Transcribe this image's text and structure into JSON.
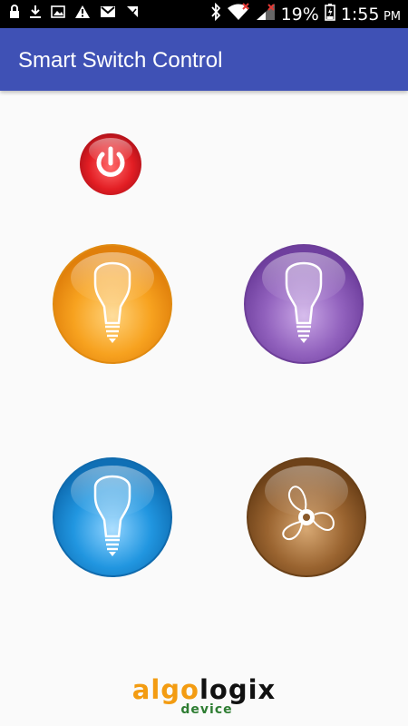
{
  "status_bar": {
    "battery_percent": "19%",
    "time": "1:55",
    "ampm": "PM",
    "icons": [
      "lock-icon",
      "download-icon",
      "image-icon",
      "warning-icon",
      "gmail-icon",
      "check-icon",
      "bluetooth-icon",
      "wifi-icon",
      "signal-icon",
      "battery-icon"
    ]
  },
  "app_bar": {
    "title": "Smart Switch Control",
    "color": "#3f51b5"
  },
  "controls": {
    "power": {
      "icon": "power-icon",
      "color": "#e31e24"
    },
    "switches": [
      {
        "icon": "light-bulb-icon",
        "color": "#f5a01f"
      },
      {
        "icon": "light-bulb-icon",
        "color": "#8e5bb5"
      },
      {
        "icon": "light-bulb-icon",
        "color": "#1f8fd6"
      },
      {
        "icon": "fan-icon",
        "color": "#8a5a2b"
      }
    ]
  },
  "logo": {
    "part1": "algo",
    "part2": "logix",
    "sub": "device"
  }
}
